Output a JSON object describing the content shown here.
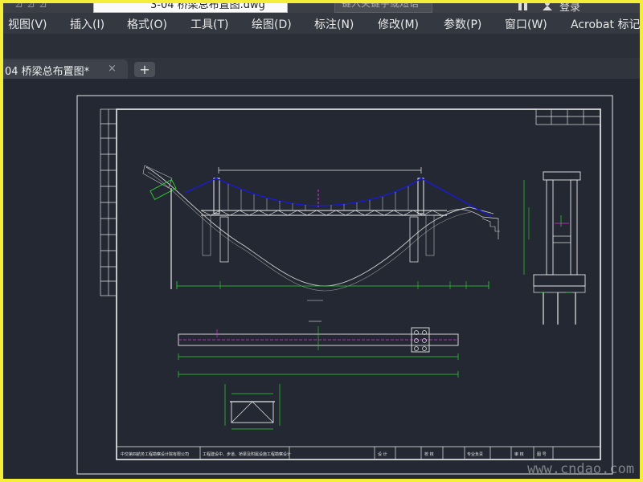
{
  "titlebar": {
    "document_title": "3-04 桥梁总布置图.dwg",
    "search_placeholder": "键入关键字或短语",
    "login_label": "登录"
  },
  "menu": [
    {
      "label": "视图(V)"
    },
    {
      "label": "插入(I)"
    },
    {
      "label": "格式(O)"
    },
    {
      "label": "工具(T)"
    },
    {
      "label": "绘图(D)"
    },
    {
      "label": "标注(N)"
    },
    {
      "label": "修改(M)"
    },
    {
      "label": "参数(P)"
    },
    {
      "label": "窗口(W)"
    },
    {
      "label": "Acrobat 标记"
    }
  ],
  "tabs": {
    "active_label": "04 桥梁总布置图*",
    "close_symbol": "×",
    "new_tab_symbol": "+"
  },
  "title_block": {
    "designer_org": "中交第四航务工程勘察设计院有限公司",
    "project_name": "工程建设中、步道、桥梁及附属设施工程勘察设计",
    "cells": [
      "设 计",
      "校 核",
      "专业负责",
      "审 核",
      "图 号"
    ]
  },
  "watermark": "www.cndao.com",
  "colors": {
    "accent_yellow": "#f4ee3a",
    "model_background": "#232832",
    "cable_blue": "#1a1ad8",
    "dimension_green": "#2dd62d",
    "centerline_magenta": "#e030e0"
  }
}
